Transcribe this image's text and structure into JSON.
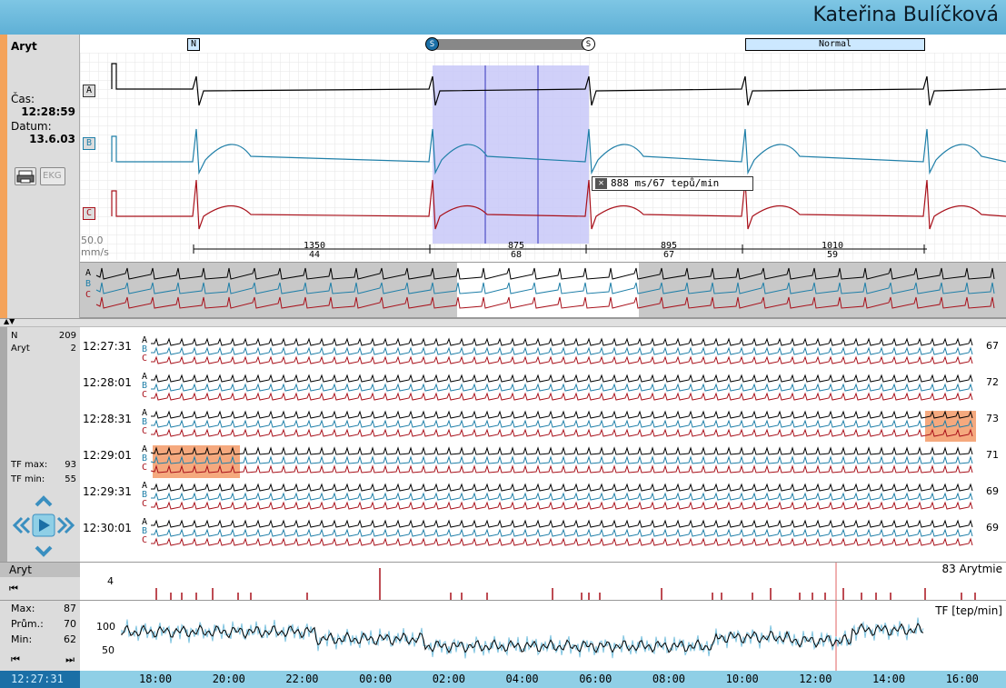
{
  "header": {
    "patient_name": "Kateřina Bulíčková"
  },
  "top_panel": {
    "mode": "Aryt",
    "time_label": "Čas:",
    "time_value": "12:28:59",
    "date_label": "Datum:",
    "date_value": "13.6.03",
    "print_icon": "printer-icon",
    "ekg_button": "EKG"
  },
  "ecg": {
    "beat_label_n": "N",
    "marker_left": "S",
    "marker_right": "S",
    "rhythm_label": "Normal",
    "leads": [
      "A",
      "B",
      "C"
    ],
    "speed": "50.0",
    "speed_unit": "mm/s",
    "measure_tooltip": "888 ms/67 tepů/min",
    "intervals": [
      {
        "ms": "1350",
        "bpm": "44"
      },
      {
        "ms": "875",
        "bpm": "68"
      },
      {
        "ms": "895",
        "bpm": "67"
      },
      {
        "ms": "1010",
        "bpm": "59"
      }
    ]
  },
  "strip_panel": {
    "counts": [
      {
        "label": "N",
        "value": "209"
      },
      {
        "label": "Aryt",
        "value": "2"
      }
    ],
    "tf_max_label": "TF max:",
    "tf_max": "93",
    "tf_min_label": "TF min:",
    "tf_min": "55",
    "rows": [
      {
        "time": "12:27:31",
        "rate": "67"
      },
      {
        "time": "12:28:01",
        "rate": "72"
      },
      {
        "time": "12:28:31",
        "rate": "73"
      },
      {
        "time": "12:29:01",
        "rate": "71"
      },
      {
        "time": "12:29:31",
        "rate": "69"
      },
      {
        "time": "12:30:01",
        "rate": "69"
      }
    ]
  },
  "aryt_panel": {
    "title": "Aryt",
    "scale": "4",
    "count_label": "83 Arytmie"
  },
  "tf_panel": {
    "max_label": "Max:",
    "max": "87",
    "avg_label": "Prům.:",
    "avg": "70",
    "min_label": "Min:",
    "min": "62",
    "y_ticks": [
      "100",
      "50"
    ],
    "unit_label": "TF [tep/min]"
  },
  "timeline": {
    "current": "12:27:31",
    "ticks": [
      "18:00",
      "20:00",
      "22:00",
      "00:00",
      "02:00",
      "04:00",
      "06:00",
      "08:00",
      "10:00",
      "12:00",
      "14:00",
      "16:00"
    ]
  },
  "colors": {
    "lead_a": "#000000",
    "lead_b": "#1f7fa8",
    "lead_c": "#a8101a",
    "selection": "#c8c8f8",
    "highlight": "#f4a070"
  }
}
